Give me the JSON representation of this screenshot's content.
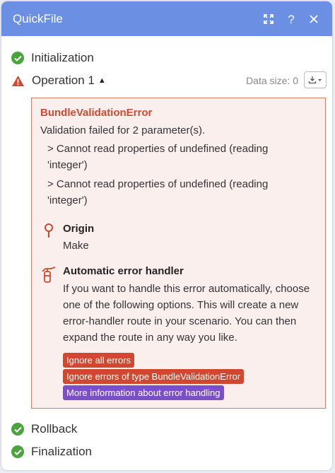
{
  "header": {
    "title": "QuickFile"
  },
  "steps": {
    "initialization": "Initialization",
    "operation": "Operation 1",
    "rollback": "Rollback",
    "finalization": "Finalization"
  },
  "data_size": "Data size: 0",
  "error": {
    "name": "BundleValidationError",
    "message": "Validation failed for 2 parameter(s).",
    "params": [
      "> Cannot read properties of undefined (reading 'integer')",
      "> Cannot read properties of undefined (reading 'integer')"
    ]
  },
  "origin": {
    "title": "Origin",
    "value": "Make"
  },
  "handler": {
    "title": "Automatic error handler",
    "text": "If you want to handle this error automatically, choose one of the following options. This will create a new error-handler route in your scenario. You can then expand the route in any way you like.",
    "buttons": {
      "ignore_all": "Ignore all errors",
      "ignore_type": "Ignore errors of type BundleValidationError",
      "more_info": "More information about error handling"
    }
  },
  "colors": {
    "header_bg": "#6b8fe3",
    "success": "#4aa33d",
    "error_red": "#d1482f",
    "error_bg": "#fbefee",
    "badge_red": "#d1482f",
    "badge_purple": "#7b4fc9"
  },
  "icons": {
    "header": [
      "expand-icon",
      "help-icon",
      "close-icon"
    ],
    "status": [
      "check-icon",
      "warning-icon"
    ],
    "sections": [
      "origin-pin-icon",
      "fire-extinguisher-icon"
    ],
    "download": "download-icon"
  }
}
